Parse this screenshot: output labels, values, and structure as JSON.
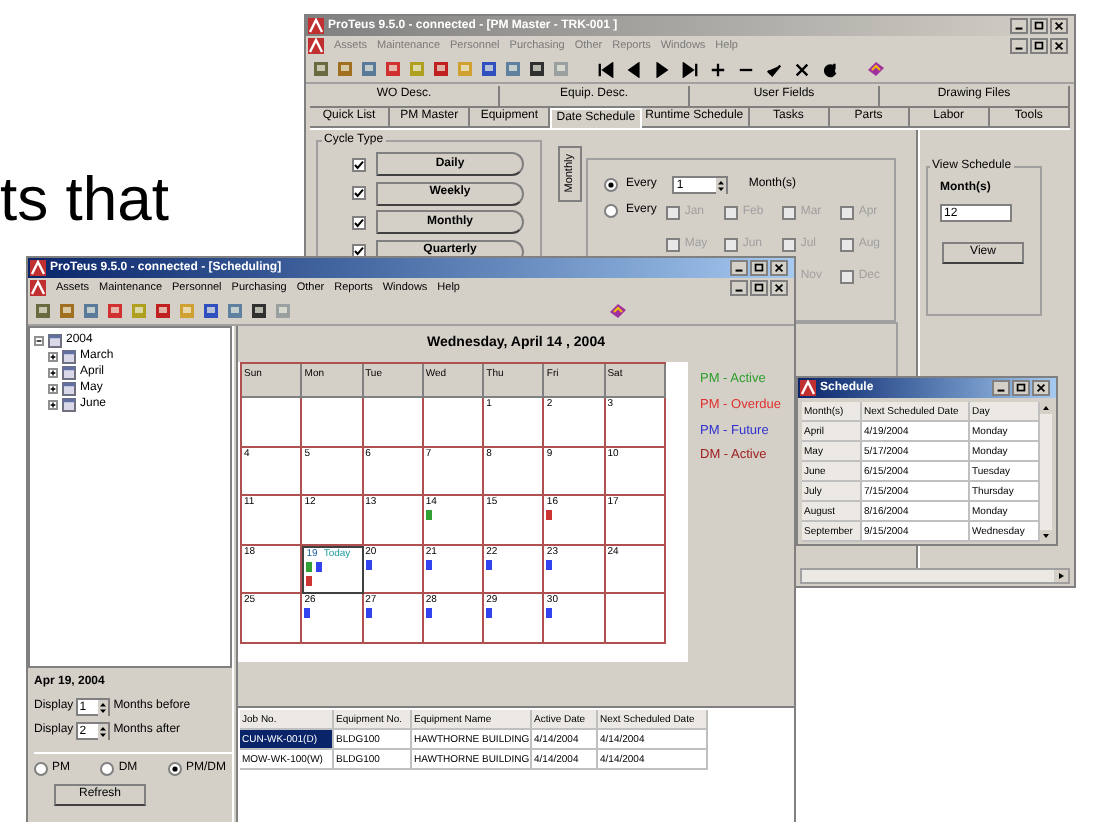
{
  "headline_fragment": "ts that",
  "pm_master_window": {
    "title": "ProTeus 9.5.0 - connected - [PM Master - TRK-001 ]",
    "menu": [
      "Assets",
      "Maintenance",
      "Personnel",
      "Purchasing",
      "Other",
      "Reports",
      "Windows",
      "Help"
    ],
    "tab_rows": [
      [
        {
          "label": "WO Desc.",
          "selected": false
        },
        {
          "label": "Equip. Desc.",
          "selected": false
        },
        {
          "label": "User Fields",
          "selected": false
        },
        {
          "label": "Drawing Files",
          "selected": false
        }
      ],
      [
        {
          "label": "Quick List",
          "selected": false
        },
        {
          "label": "PM Master",
          "selected": false
        },
        {
          "label": "Equipment",
          "selected": false
        },
        {
          "label": "Date Schedule",
          "selected": true
        },
        {
          "label": "Runtime Schedule",
          "selected": false
        },
        {
          "label": "Tasks",
          "selected": false
        },
        {
          "label": "Parts",
          "selected": false
        },
        {
          "label": "Labor",
          "selected": false
        },
        {
          "label": "Tools",
          "selected": false
        }
      ]
    ],
    "cycle_type": {
      "label": "Cycle Type",
      "items": [
        {
          "label": "Daily",
          "checked": true
        },
        {
          "label": "Weekly",
          "checked": true
        },
        {
          "label": "Monthly",
          "checked": true
        },
        {
          "label": "Quarterly",
          "checked": true
        }
      ]
    },
    "side_tab": "Monthly",
    "every_options": [
      {
        "kind": "interval",
        "label": "Every",
        "selected": true,
        "value": "1",
        "unit": "Month(s)"
      },
      {
        "kind": "months",
        "label": "Every",
        "selected": false,
        "disabled": true,
        "months": [
          {
            "label": "Jan",
            "checked": false
          },
          {
            "label": "Feb",
            "checked": false
          },
          {
            "label": "Mar",
            "checked": false
          },
          {
            "label": "Apr",
            "checked": false
          },
          {
            "label": "May",
            "checked": false
          },
          {
            "label": "Jun",
            "checked": false
          },
          {
            "label": "Jul",
            "checked": false
          },
          {
            "label": "Aug",
            "checked": false
          },
          {
            "label": "Nov"
          },
          {
            "label": "Dec",
            "checked": false
          }
        ]
      }
    ],
    "view_schedule": {
      "label": "View Schedule",
      "field_label": "Month(s)",
      "value": "12",
      "button": "View"
    }
  },
  "scheduling_window": {
    "title": "ProTeus 9.5.0 - connected - [Scheduling]",
    "menu": [
      "Assets",
      "Maintenance",
      "Personnel",
      "Purchasing",
      "Other",
      "Reports",
      "Windows",
      "Help"
    ],
    "tree": [
      {
        "label": "2004",
        "expanded": true,
        "children": [
          {
            "label": "March",
            "expanded": false
          },
          {
            "label": "April",
            "expanded": false
          },
          {
            "label": "May",
            "expanded": false
          },
          {
            "label": "June",
            "expanded": false
          }
        ]
      }
    ],
    "current_date": "Apr 19, 2004",
    "ranges": [
      {
        "label": "Display",
        "value": "1",
        "suffix": "Months before"
      },
      {
        "label": "Display",
        "value": "2",
        "suffix": "Months after"
      }
    ],
    "filter": [
      {
        "label": "PM",
        "selected": false
      },
      {
        "label": "DM",
        "selected": false
      },
      {
        "label": "PM/DM",
        "selected": true
      }
    ],
    "refresh_button": "Refresh",
    "calendar": {
      "title": "Wednesday, April 14 , 2004",
      "weekdays": [
        "Sun",
        "Mon",
        "Tue",
        "Wed",
        "Thu",
        "Fri",
        "Sat"
      ],
      "weeks": [
        [
          {
            "kind": "blank"
          },
          {
            "kind": "blank"
          },
          {
            "kind": "blank"
          },
          {
            "kind": "blank"
          },
          {
            "day": "1"
          },
          {
            "day": "2"
          },
          {
            "day": "3"
          }
        ],
        [
          {
            "day": "4"
          },
          {
            "day": "5"
          },
          {
            "day": "6"
          },
          {
            "day": "7"
          },
          {
            "day": "8"
          },
          {
            "day": "9"
          },
          {
            "day": "10"
          }
        ],
        [
          {
            "day": "11"
          },
          {
            "day": "12"
          },
          {
            "day": "13"
          },
          {
            "day": "14",
            "markers": [
              {
                "color": "#33a033"
              }
            ]
          },
          {
            "day": "15"
          },
          {
            "day": "16",
            "markers": [
              {
                "color": "#cc3333"
              }
            ]
          },
          {
            "day": "17"
          }
        ],
        [
          {
            "day": "18"
          },
          {
            "day": "19",
            "today": true,
            "today_label": "Today",
            "markers": [
              {
                "color": "#33a033"
              },
              {
                "color": "#3344ee"
              },
              {
                "color": "#cc3333"
              }
            ]
          },
          {
            "day": "20",
            "markers": [
              {
                "color": "#3344ee"
              }
            ]
          },
          {
            "day": "21",
            "markers": [
              {
                "color": "#3344ee"
              }
            ]
          },
          {
            "day": "22",
            "markers": [
              {
                "color": "#3344ee"
              }
            ]
          },
          {
            "day": "23",
            "markers": [
              {
                "color": "#3344ee"
              }
            ]
          },
          {
            "day": "24"
          }
        ],
        [
          {
            "day": "25"
          },
          {
            "day": "26",
            "markers": [
              {
                "color": "#3344ee"
              }
            ]
          },
          {
            "day": "27",
            "markers": [
              {
                "color": "#3344ee"
              }
            ]
          },
          {
            "day": "28",
            "markers": [
              {
                "color": "#3344ee"
              }
            ]
          },
          {
            "day": "29",
            "markers": [
              {
                "color": "#3344ee"
              }
            ]
          },
          {
            "day": "30",
            "markers": [
              {
                "color": "#3344ee"
              }
            ]
          },
          {
            "kind": "blank"
          }
        ]
      ]
    },
    "legend": [
      {
        "label": "PM - Active",
        "color": "#2e9e2e"
      },
      {
        "label": "PM - Overdue",
        "color": "#e03030"
      },
      {
        "label": "PM - Future",
        "color": "#3030d0"
      },
      {
        "label": "DM - Active",
        "color": "#a02020"
      }
    ],
    "jobs_table": {
      "columns": [
        "Job No.",
        "Equipment No.",
        "Equipment Name",
        "Active Date",
        "Next Scheduled Date"
      ],
      "rows": [
        {
          "cells": [
            "CUN-WK-001(D)",
            "BLDG100",
            "HAWTHORNE BUILDING",
            "4/14/2004",
            "4/14/2004"
          ],
          "selected": true
        },
        {
          "cells": [
            "MOW-WK-100(W)",
            "BLDG100",
            "HAWTHORNE BUILDING",
            "4/14/2004",
            "4/14/2004"
          ],
          "selected": false
        }
      ]
    }
  },
  "schedule_window": {
    "title": "Schedule",
    "columns": [
      "Month(s)",
      "Next Scheduled Date",
      "Day"
    ],
    "rows": [
      [
        "April",
        "4/19/2004",
        "Monday"
      ],
      [
        "May",
        "5/17/2004",
        "Monday"
      ],
      [
        "June",
        "6/15/2004",
        "Tuesday"
      ],
      [
        "July",
        "7/15/2004",
        "Thursday"
      ],
      [
        "August",
        "8/16/2004",
        "Monday"
      ],
      [
        "September",
        "9/15/2004",
        "Wednesday"
      ]
    ]
  }
}
